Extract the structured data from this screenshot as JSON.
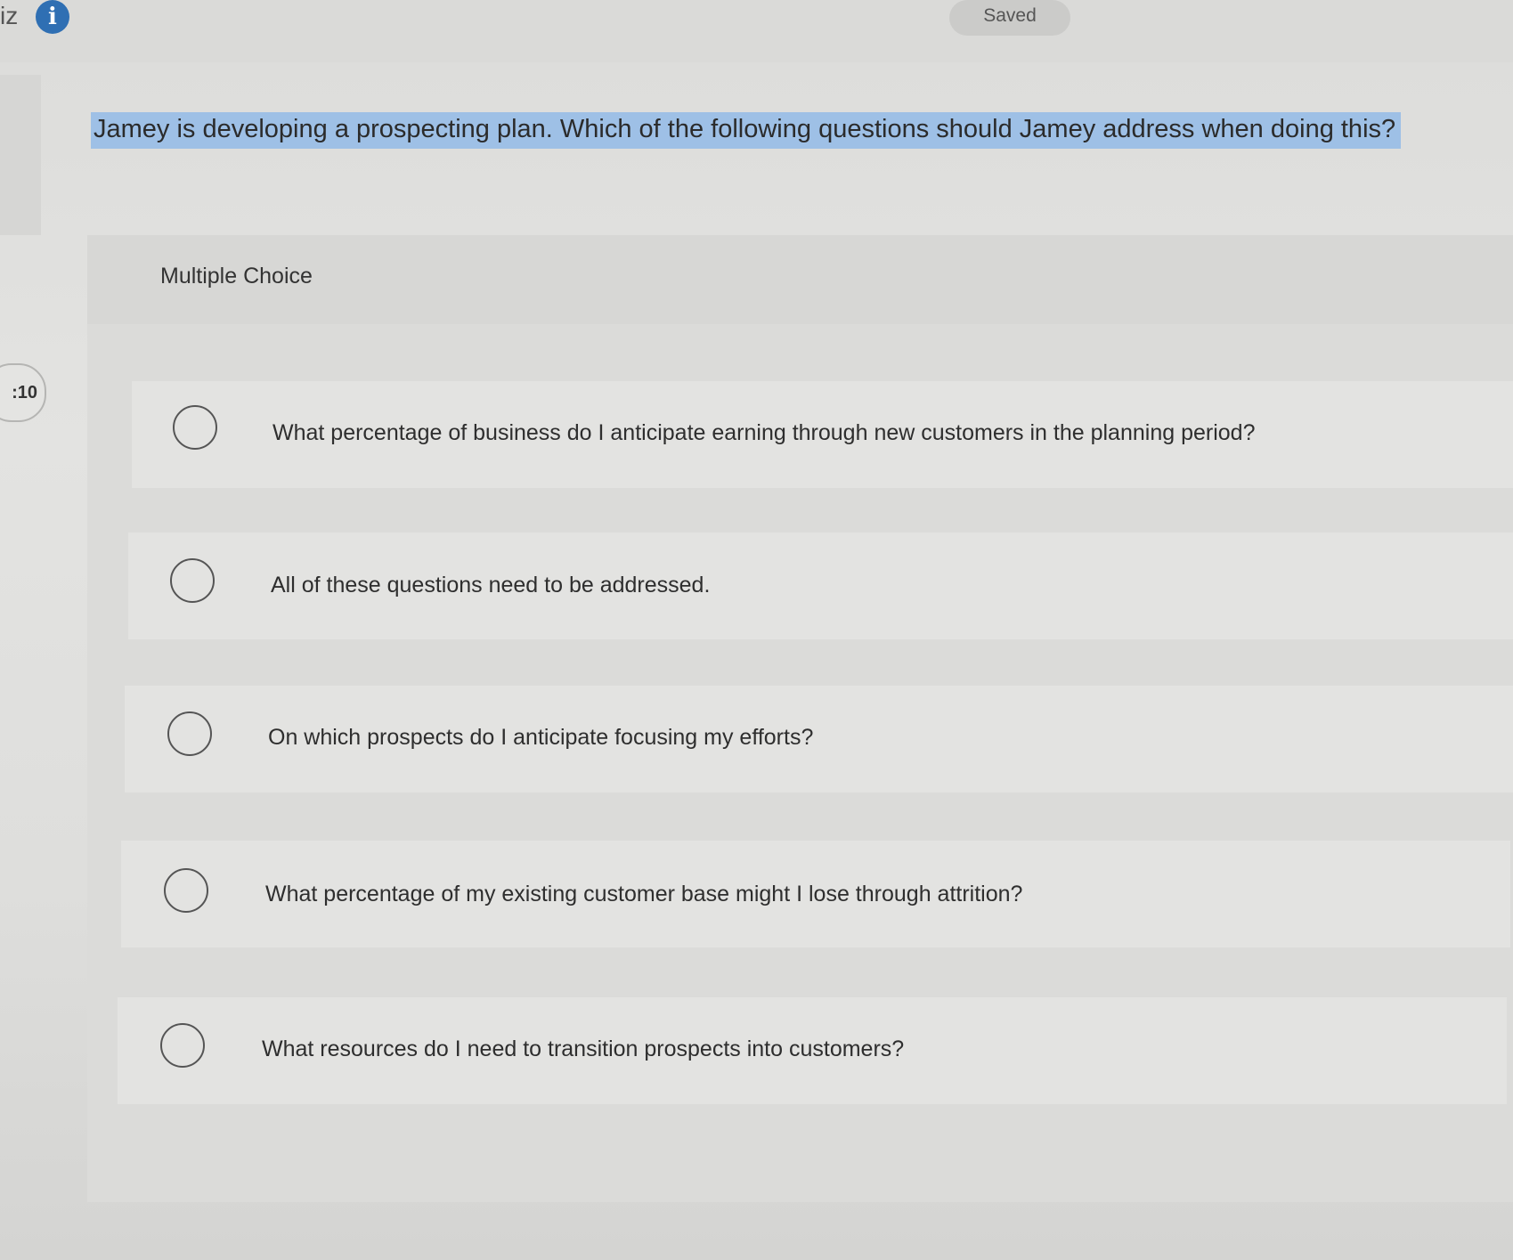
{
  "header": {
    "quiz_label": "iz",
    "info_icon": "i",
    "status": "Saved"
  },
  "timer": {
    "text": ":10"
  },
  "question": {
    "text": "Jamey is developing a prospecting plan. Which of the following questions should Jamey address when doing this?"
  },
  "multiple_choice": {
    "label": "Multiple Choice",
    "options": [
      {
        "label": "What percentage of business do I anticipate earning through new customers in the planning period?",
        "selected": false
      },
      {
        "label": "All of these questions need to be addressed.",
        "selected": false
      },
      {
        "label": "On which prospects do I anticipate focusing my efforts?",
        "selected": false
      },
      {
        "label": "What percentage of my existing customer base might I lose through attrition?",
        "selected": false
      },
      {
        "label": "What resources do I need to transition prospects into customers?",
        "selected": false
      }
    ]
  },
  "colors": {
    "highlight": "#9ec0e6",
    "info_icon": "#2f6fb3",
    "background": "#dcdcda"
  }
}
